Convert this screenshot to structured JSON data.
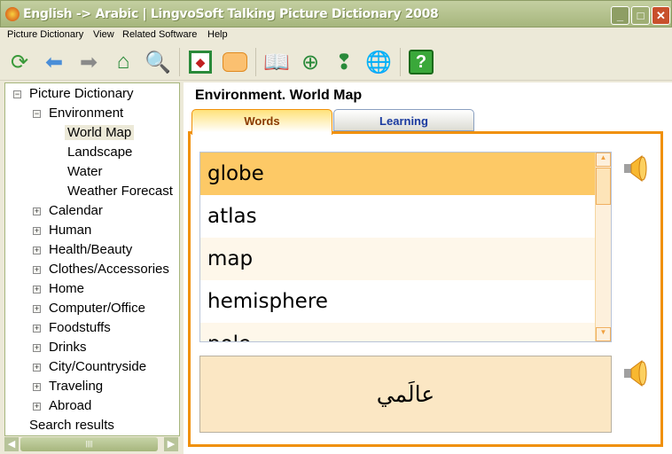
{
  "window": {
    "title": "English -> Arabic | LingvoSoft Talking Picture Dictionary 2008"
  },
  "menu": [
    "Picture Dictionary",
    "View",
    "Related Software",
    "Help"
  ],
  "toolbar": [
    "refresh-icon",
    "back-arrow-icon",
    "forward-arrow-icon",
    "home-icon",
    "search-icon",
    "picture-icon",
    "speech-bubble-icon",
    "book-search-icon",
    "add-card-icon",
    "add-card-alert-icon",
    "web-search-icon",
    "help-icon"
  ],
  "tree": {
    "root": "Picture Dictionary",
    "environment": "Environment",
    "env_children": [
      "World Map",
      "Landscape",
      "Water",
      "Weather Forecast"
    ],
    "categories": [
      "Calendar",
      "Human",
      "Health/Beauty",
      "Clothes/Accessories",
      "Home",
      "Computer/Office",
      "Foodstuffs",
      "Drinks",
      "City/Countryside",
      "Traveling",
      "Abroad"
    ],
    "search": "Search results",
    "selected": "World Map"
  },
  "main": {
    "heading": "Environment. World Map",
    "tabs": [
      {
        "label": "Words",
        "active": true
      },
      {
        "label": "Learning",
        "active": false
      }
    ],
    "words": [
      "globe",
      "atlas",
      "map",
      "hemisphere",
      "pole"
    ],
    "selected_word": "globe",
    "translation": "عالَمي"
  },
  "colors": {
    "accent": "#f0900a",
    "selected_row": "#fdc966",
    "translation_bg": "#fbe7c4"
  }
}
